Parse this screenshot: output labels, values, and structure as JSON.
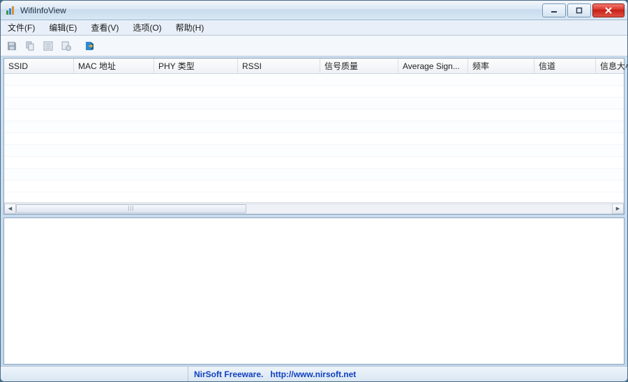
{
  "window": {
    "title": "WifiInfoView"
  },
  "menubar": {
    "items": [
      {
        "label": "文件(F)"
      },
      {
        "label": "编辑(E)"
      },
      {
        "label": "查看(V)"
      },
      {
        "label": "选项(O)"
      },
      {
        "label": "帮助(H)"
      }
    ]
  },
  "toolbar": {
    "icons": [
      {
        "name": "save-icon"
      },
      {
        "name": "copy-icon"
      },
      {
        "name": "properties-icon"
      },
      {
        "name": "options-icon"
      },
      {
        "name": "refresh-icon"
      },
      {
        "name": "exit-icon"
      }
    ]
  },
  "columns": [
    {
      "label": "SSID",
      "width": 100
    },
    {
      "label": "MAC 地址",
      "width": 115
    },
    {
      "label": "PHY 类型",
      "width": 120
    },
    {
      "label": "RSSI",
      "width": 118
    },
    {
      "label": "信号质量",
      "width": 112
    },
    {
      "label": "Average Sign...",
      "width": 100
    },
    {
      "label": "频率",
      "width": 95
    },
    {
      "label": "信道",
      "width": 88
    },
    {
      "label": "信息大小",
      "width": 70
    }
  ],
  "statusbar": {
    "product": "NirSoft Freeware.",
    "url": "http://www.nirsoft.net"
  }
}
